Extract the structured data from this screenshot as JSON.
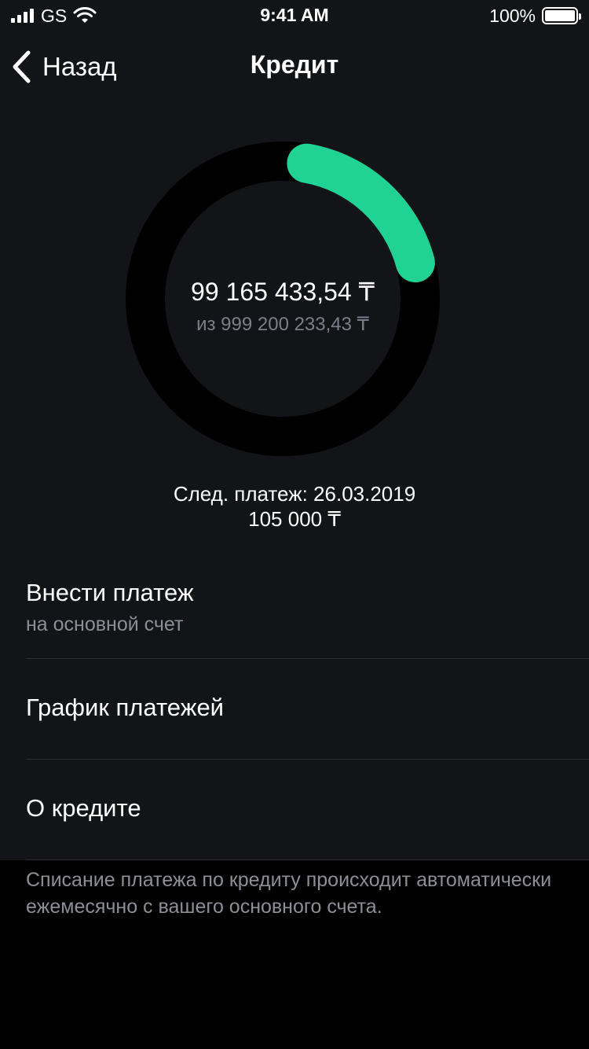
{
  "status_bar": {
    "carrier": "GS",
    "time": "9:41 AM",
    "battery": "100%"
  },
  "nav": {
    "back_label": "Назад",
    "title": "Кредит"
  },
  "credit": {
    "remaining": "99 165 433,54 ₸",
    "total": "из 999 200 233,43 ₸",
    "progress_fraction": 0.18,
    "ring_color": "#20d394",
    "track_color": "#000000"
  },
  "next_payment": {
    "label": "След. платеж: 26.03.2019",
    "amount": "105 000 ₸"
  },
  "menu": {
    "items": [
      {
        "title": "Внести платеж",
        "subtitle": "на основной счет"
      },
      {
        "title": "График платежей"
      },
      {
        "title": "О кредите"
      }
    ]
  },
  "footer_note": "Списание платежа по кредиту происходит автоматически ежемесячно с вашего основного счета."
}
